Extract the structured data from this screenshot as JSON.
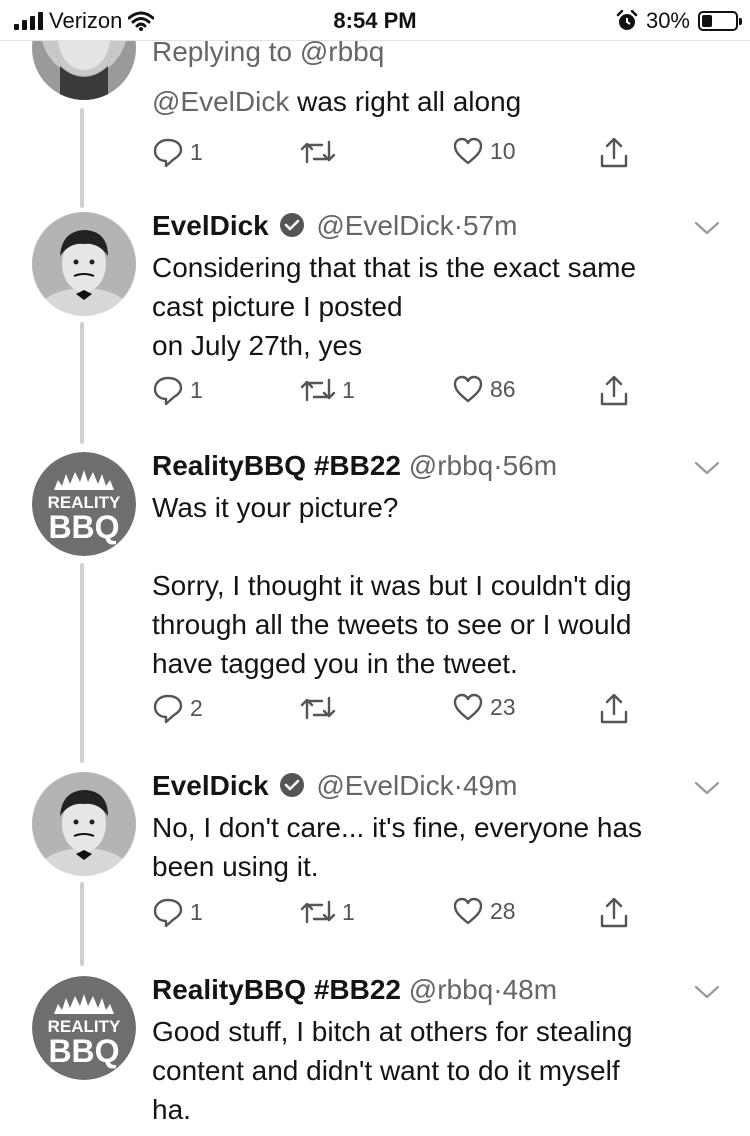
{
  "status_bar": {
    "carrier": "Verizon",
    "time": "8:54 PM",
    "battery_percent": "30%",
    "battery_level": 0.3
  },
  "thread": {
    "reply_context": {
      "replying_to_label": "Replying to @rbbq",
      "mention": "@EvelDick",
      "text": " was right all along",
      "replies": "1",
      "retweets": "",
      "likes": "10"
    },
    "tweets": [
      {
        "name": "EvelDick",
        "verified": true,
        "handle": "@EvelDick",
        "separator": "·",
        "time": "57m",
        "lines": [
          "Considering that that is the exact same",
          "cast picture I posted",
          "on July 27th, yes"
        ],
        "replies": "1",
        "retweets": "1",
        "likes": "86",
        "avatar_icon": "person-photo-icon"
      },
      {
        "name": "RealityBBQ #BB22",
        "verified": false,
        "handle": "@rbbq",
        "separator": "·",
        "time": "56m",
        "lines": [
          "Was it your picture?",
          "",
          "Sorry, I thought it was but I couldn't dig",
          "through all the tweets to see or I would",
          "have tagged you in the tweet."
        ],
        "replies": "2",
        "retweets": "",
        "likes": "23",
        "avatar_icon": "reality-bbq-logo",
        "logo_top": "REALITY",
        "logo_bottom": "BBQ"
      },
      {
        "name": "EvelDick",
        "verified": true,
        "handle": "@EvelDick",
        "separator": "·",
        "time": "49m",
        "lines": [
          "No, I don't care... it's fine, everyone has",
          "been using it."
        ],
        "replies": "1",
        "retweets": "1",
        "likes": "28",
        "avatar_icon": "person-photo-icon"
      },
      {
        "name": "RealityBBQ #BB22",
        "verified": false,
        "handle": "@rbbq",
        "separator": "·",
        "time": "48m",
        "lines": [
          "Good stuff, I bitch at others for stealing",
          "content and didn't want to do it myself",
          "ha."
        ],
        "avatar_icon": "reality-bbq-logo",
        "logo_top": "REALITY",
        "logo_bottom": "BBQ"
      }
    ]
  },
  "colors": {
    "text": "#141414",
    "secondary": "#666666",
    "thread_line": "#d0d0d0",
    "verified": "#555555"
  }
}
